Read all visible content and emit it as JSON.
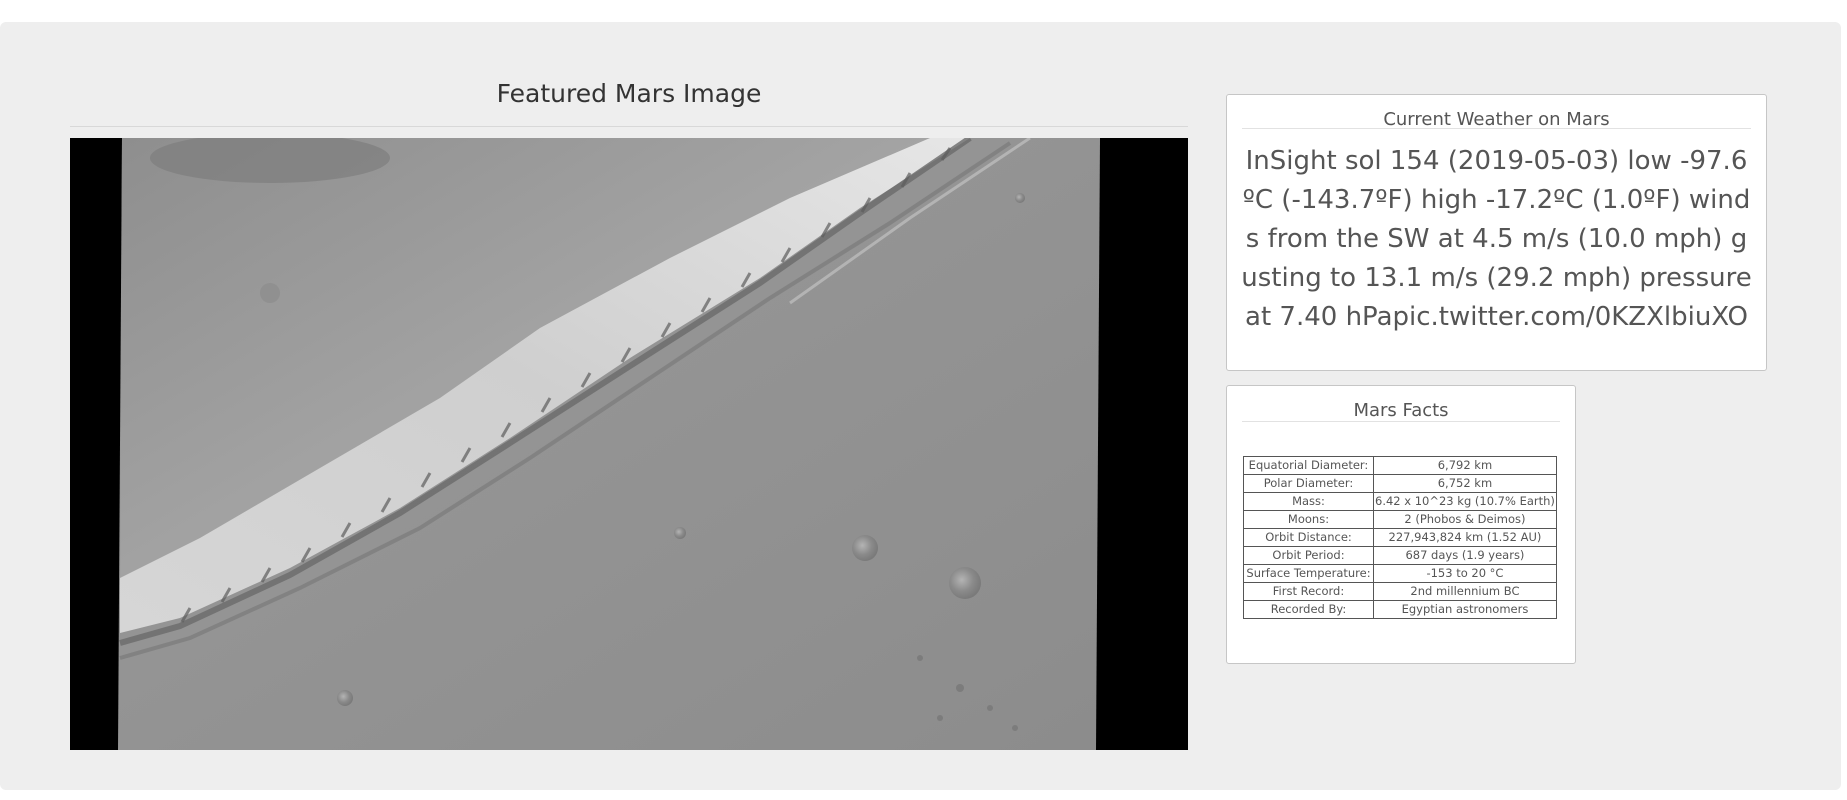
{
  "featured": {
    "title": "Featured Mars Image",
    "image_alt": "Grayscale orbital view of a Martian scarp and canyon wall"
  },
  "weather": {
    "title": "Current Weather on Mars",
    "text": "InSight sol 154 (2019-05-03) low -97.6ºC (-143.7ºF) high -17.2ºC (1.0ºF) winds from the SW at 4.5 m/s (10.0 mph) gusting to 13.1 m/s (29.2 mph) pressure at 7.40 hPapic.twitter.com/0KZXlbiuXO"
  },
  "facts": {
    "title": "Mars Facts",
    "rows": [
      {
        "label": "Equatorial Diameter:",
        "value": "6,792 km"
      },
      {
        "label": "Polar Diameter:",
        "value": "6,752 km"
      },
      {
        "label": "Mass:",
        "value": "6.42 x 10^23 kg (10.7% Earth)"
      },
      {
        "label": "Moons:",
        "value": "2 (Phobos & Deimos)"
      },
      {
        "label": "Orbit Distance:",
        "value": "227,943,824 km (1.52 AU)"
      },
      {
        "label": "Orbit Period:",
        "value": "687 days (1.9 years)"
      },
      {
        "label": "Surface Temperature:",
        "value": "-153 to 20 °C"
      },
      {
        "label": "First Record:",
        "value": "2nd millennium BC"
      },
      {
        "label": "Recorded By:",
        "value": "Egyptian astronomers"
      }
    ]
  },
  "colors": {
    "background": "#eeeeee",
    "panel_border": "#c6c6c6",
    "text": "#555555"
  }
}
